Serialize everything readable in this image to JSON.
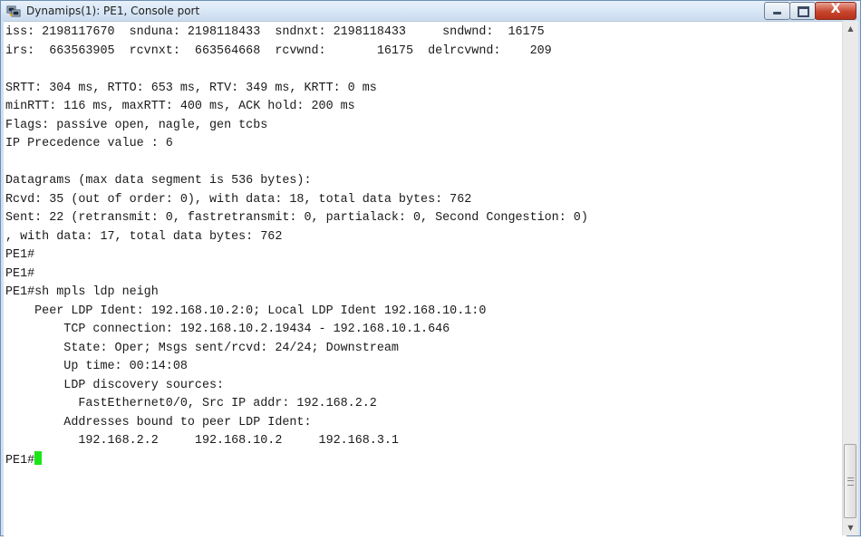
{
  "window": {
    "title": "Dynamips(1): PE1, Console port",
    "icon": "putty-terminal-icon",
    "controls": {
      "minimize_icon": "minimize-icon",
      "maximize_icon": "maximize-icon",
      "close_glyph": "X"
    }
  },
  "console": {
    "lines": [
      "iss: 2198117670  snduna: 2198118433  sndnxt: 2198118433     sndwnd:  16175",
      "irs:  663563905  rcvnxt:  663564668  rcvwnd:       16175  delrcvwnd:    209",
      "",
      "SRTT: 304 ms, RTTO: 653 ms, RTV: 349 ms, KRTT: 0 ms",
      "minRTT: 116 ms, maxRTT: 400 ms, ACK hold: 200 ms",
      "Flags: passive open, nagle, gen tcbs",
      "IP Precedence value : 6",
      "",
      "Datagrams (max data segment is 536 bytes):",
      "Rcvd: 35 (out of order: 0), with data: 18, total data bytes: 762",
      "Sent: 22 (retransmit: 0, fastretransmit: 0, partialack: 0, Second Congestion: 0)",
      ", with data: 17, total data bytes: 762",
      "PE1#",
      "PE1#",
      "PE1#sh mpls ldp neigh",
      "    Peer LDP Ident: 192.168.10.2:0; Local LDP Ident 192.168.10.1:0",
      "        TCP connection: 192.168.10.2.19434 - 192.168.10.1.646",
      "        State: Oper; Msgs sent/rcvd: 24/24; Downstream",
      "        Up time: 00:14:08",
      "        LDP discovery sources:",
      "          FastEthernet0/0, Src IP addr: 192.168.2.2",
      "        Addresses bound to peer LDP Ident:",
      "          192.168.2.2     192.168.10.2     192.168.3.1"
    ],
    "prompt": "PE1#",
    "cursor_color": "#19e619"
  },
  "scrollbar": {
    "up_glyph": "▲",
    "down_glyph": "▼",
    "position": 0.95
  }
}
